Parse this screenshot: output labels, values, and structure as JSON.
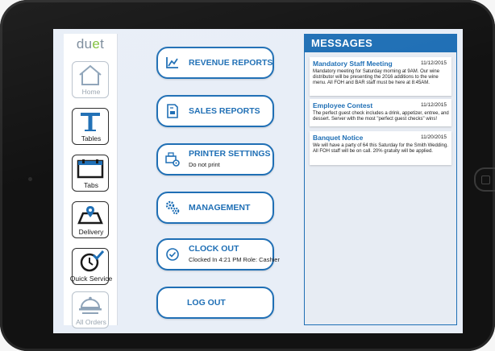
{
  "app": {
    "logo_text": "duet",
    "logo_dot": "e",
    "accent_color": "#1f6fb5",
    "logo_dot_color": "#7ec03a"
  },
  "sidebar": {
    "items": [
      {
        "label": "Home",
        "icon": "home-icon",
        "enabled": false
      },
      {
        "label": "Tables",
        "icon": "table-icon",
        "enabled": true
      },
      {
        "label": "Tabs",
        "icon": "tabs-icon",
        "enabled": true
      },
      {
        "label": "Delivery",
        "icon": "delivery-map-icon",
        "enabled": true
      },
      {
        "label": "Quick Service",
        "icon": "clock-check-icon",
        "enabled": true
      },
      {
        "label": "All Orders",
        "icon": "cloche-icon",
        "enabled": false
      }
    ]
  },
  "menu": {
    "revenue_reports": {
      "title": "REVENUE REPORTS",
      "icon": "line-chart-icon"
    },
    "sales_reports": {
      "title": "SALES REPORTS",
      "icon": "report-document-icon"
    },
    "printer_settings": {
      "title": "PRINTER SETTINGS",
      "subtitle": "Do not print",
      "icon": "printer-gear-icon"
    },
    "management": {
      "title": "MANAGEMENT",
      "icon": "gears-icon"
    },
    "clock_out": {
      "title": "CLOCK OUT",
      "subtitle": "Clocked In 4:21 PM Role: Cashier",
      "icon": "clock-icon"
    },
    "log_out": {
      "title": "LOG OUT"
    }
  },
  "messages": {
    "header": "MESSAGES",
    "items": [
      {
        "title": "Mandatory Staff Meeting",
        "date": "11/12/2015",
        "body": "Mandatory meeting for Saturday morning at 9AM. Our wine distributor will be presenting the 2016 additions to the wine menu. All FOH and BAR staff must be here at 8:45AM."
      },
      {
        "title": "Employee Contest",
        "date": "11/12/2015",
        "body": "The perfect guest check includes a drink, appetizer, entree, and dessert. Server with the most \"perfect guest checks\" wins!"
      },
      {
        "title": "Banquet Notice",
        "date": "11/20/2015",
        "body": "We will have a party of 64 this Saturday for the Smith Wedding. All FOH staff will be on call. 20% gratuity will be applied."
      }
    ]
  }
}
